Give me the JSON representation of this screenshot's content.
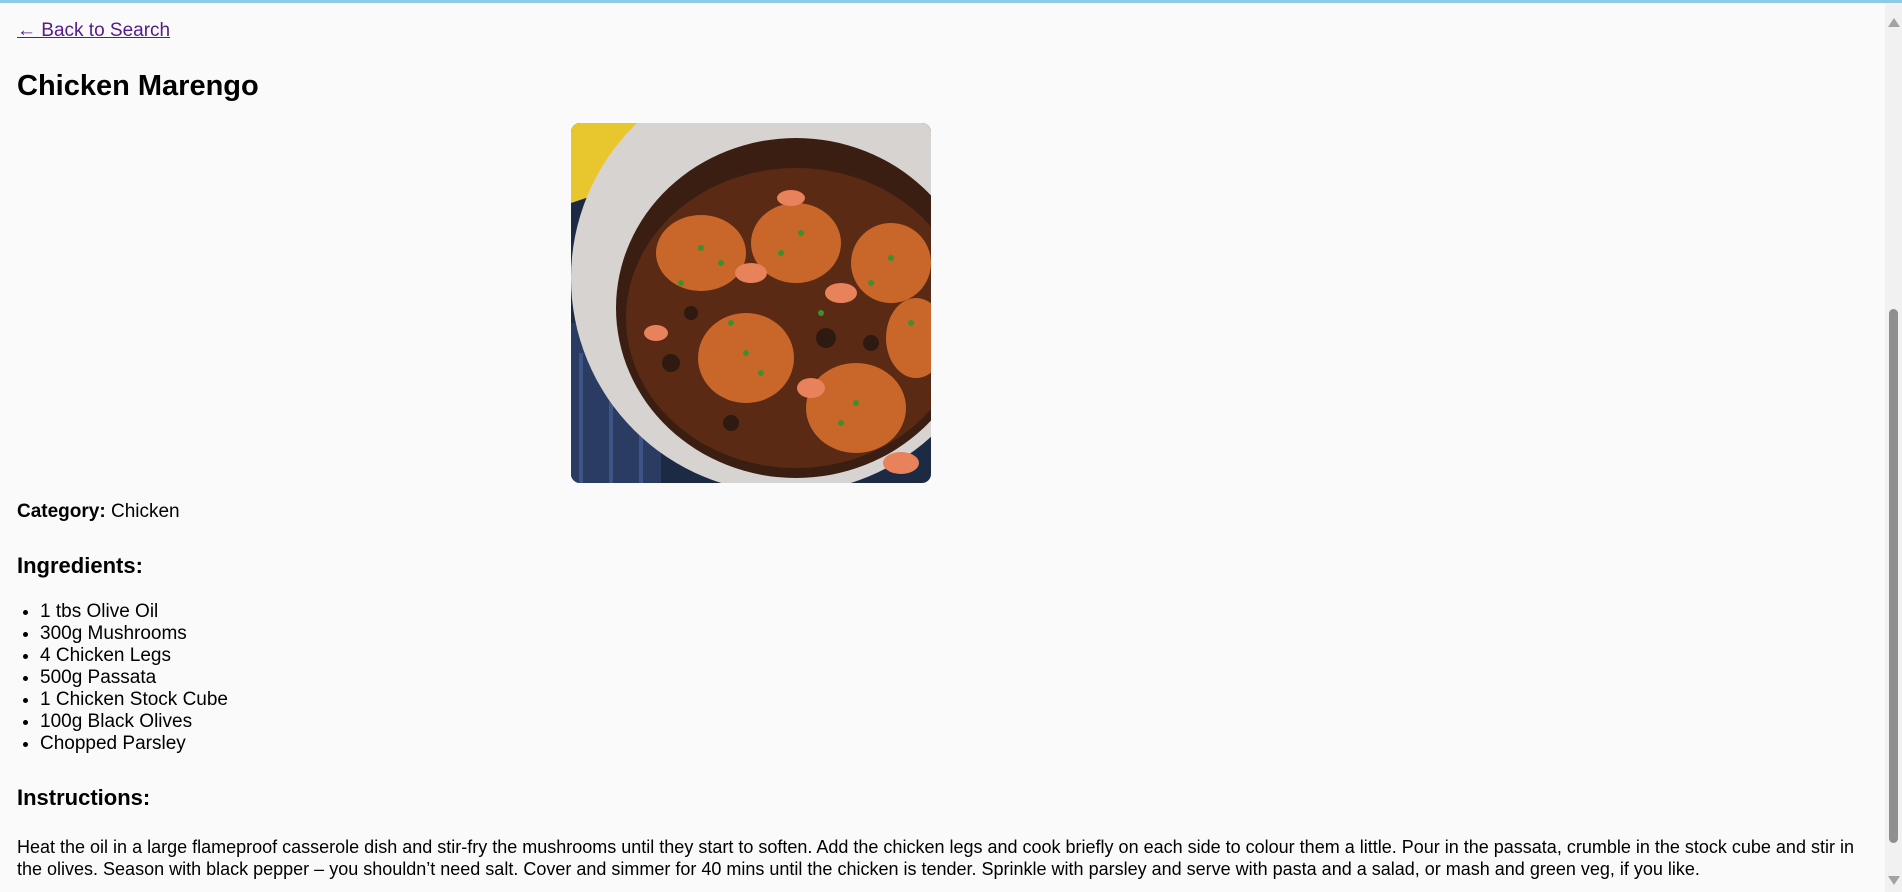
{
  "nav": {
    "back_label": "← Back to Search"
  },
  "recipe": {
    "title": "Chicken Marengo",
    "image_alt": "Chicken Marengo dish in a casserole pot",
    "category_label": "Category:",
    "category_value": "Chicken",
    "ingredients_heading": "Ingredients:",
    "ingredients": [
      "1 tbs Olive Oil",
      "300g Mushrooms",
      "4 Chicken Legs",
      "500g Passata",
      "1 Chicken Stock Cube",
      "100g Black Olives",
      "Chopped Parsley"
    ],
    "instructions_heading": "Instructions:",
    "instructions": "Heat the oil in a large flameproof casserole dish and stir-fry the mushrooms until they start to soften. Add the chicken legs and cook briefly on each side to colour them a little. Pour in the passata, crumble in the stock cube and stir in the olives. Season with black pepper – you shouldn’t need salt. Cover and simmer for 40 mins until the chicken is tender. Sprinkle with parsley and serve with pasta and a salad, or mash and green veg, if you like."
  },
  "colors": {
    "link": "#551a8b",
    "background": "#fafafa",
    "accent_bar": "#8ecae6"
  },
  "icons": {
    "scroll_up": "triangle-up-icon",
    "scroll_down": "triangle-down-icon"
  }
}
